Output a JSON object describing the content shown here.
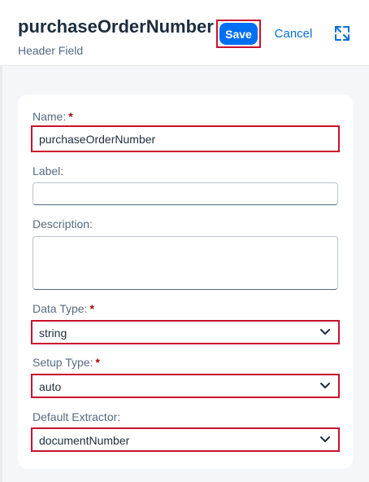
{
  "header": {
    "title": "purchaseOrderNumber",
    "subtitle": "Header Field",
    "save_label": "Save",
    "cancel_label": "Cancel",
    "expand_icon": "expand-icon"
  },
  "form": {
    "name": {
      "label": "Name:",
      "required": "*",
      "value": "purchaseOrderNumber"
    },
    "label_field": {
      "label": "Label:",
      "value": ""
    },
    "description": {
      "label": "Description:",
      "value": ""
    },
    "data_type": {
      "label": "Data Type:",
      "required": "*",
      "value": "string"
    },
    "setup_type": {
      "label": "Setup Type:",
      "required": "*",
      "value": "auto"
    },
    "default_extractor": {
      "label": "Default Extractor:",
      "value": "documentNumber"
    }
  },
  "colors": {
    "accent": "#0070f2",
    "link": "#0a6ed1",
    "highlight_border": "#c8102e",
    "required_marker": "#aa0808"
  }
}
